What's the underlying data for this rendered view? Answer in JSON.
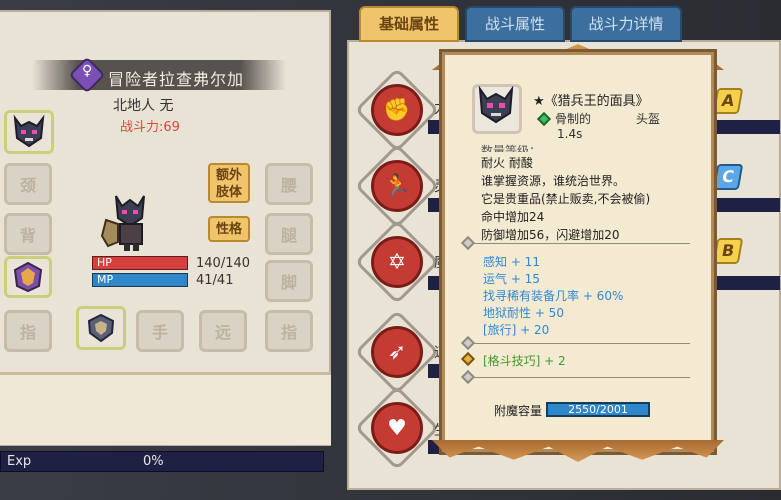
{
  "character": {
    "name": "冒险者拉查弗尔加",
    "gender_icon": "♀",
    "race": "北地人 无",
    "power": "战斗力:69",
    "hp_label": "HP",
    "mp_label": "MP",
    "hp_value": "140/140",
    "mp_value": "41/41",
    "extra_limbs_label": "额外\n肢体",
    "personality_label": "性格",
    "slots": {
      "neck": "颈",
      "back": "背",
      "hand": "手",
      "ranged": "远",
      "finger1": "指",
      "finger2": "指",
      "waist": "腰",
      "leg": "腿",
      "foot": "脚"
    }
  },
  "exp": {
    "label": "Exp",
    "value": "0%"
  },
  "tabs": [
    "基础属性",
    "战斗属性",
    "战斗力详情"
  ],
  "attributes": {
    "stubs": [
      "力",
      "灵",
      "魔",
      "速",
      "生"
    ],
    "grades": [
      "A",
      "C",
      "B"
    ]
  },
  "tooltip": {
    "item_name": "★《猎兵王的面具》",
    "material": "骨制的",
    "slot": "头盔",
    "speed": "1.4s",
    "desc_partial": "数量等级：",
    "desc_lines": [
      "耐火 耐酸",
      "谁掌握资源，谁统治世界。",
      "它是贵重品(禁止贩卖,不会被偷)",
      "命中增加24",
      "防御增加56，闪避增加20"
    ],
    "bonuses": [
      "感知 + 11",
      "运气 + 15",
      "找寻稀有装备几率 + 60%",
      "地狱耐性 + 50",
      "[旅行] + 20"
    ],
    "skill": "[格斗技巧] + 2",
    "capacity_label": "附魔容量",
    "capacity_value": "2550/2001"
  },
  "colors": {
    "hp": "#d43f3f",
    "mp": "#2f86c8",
    "tab_active": "#f0c46a",
    "tab_inactive": "#3d6f9e",
    "bonus_text": "#2f88d6",
    "skill_text": "#3f9a2a"
  }
}
